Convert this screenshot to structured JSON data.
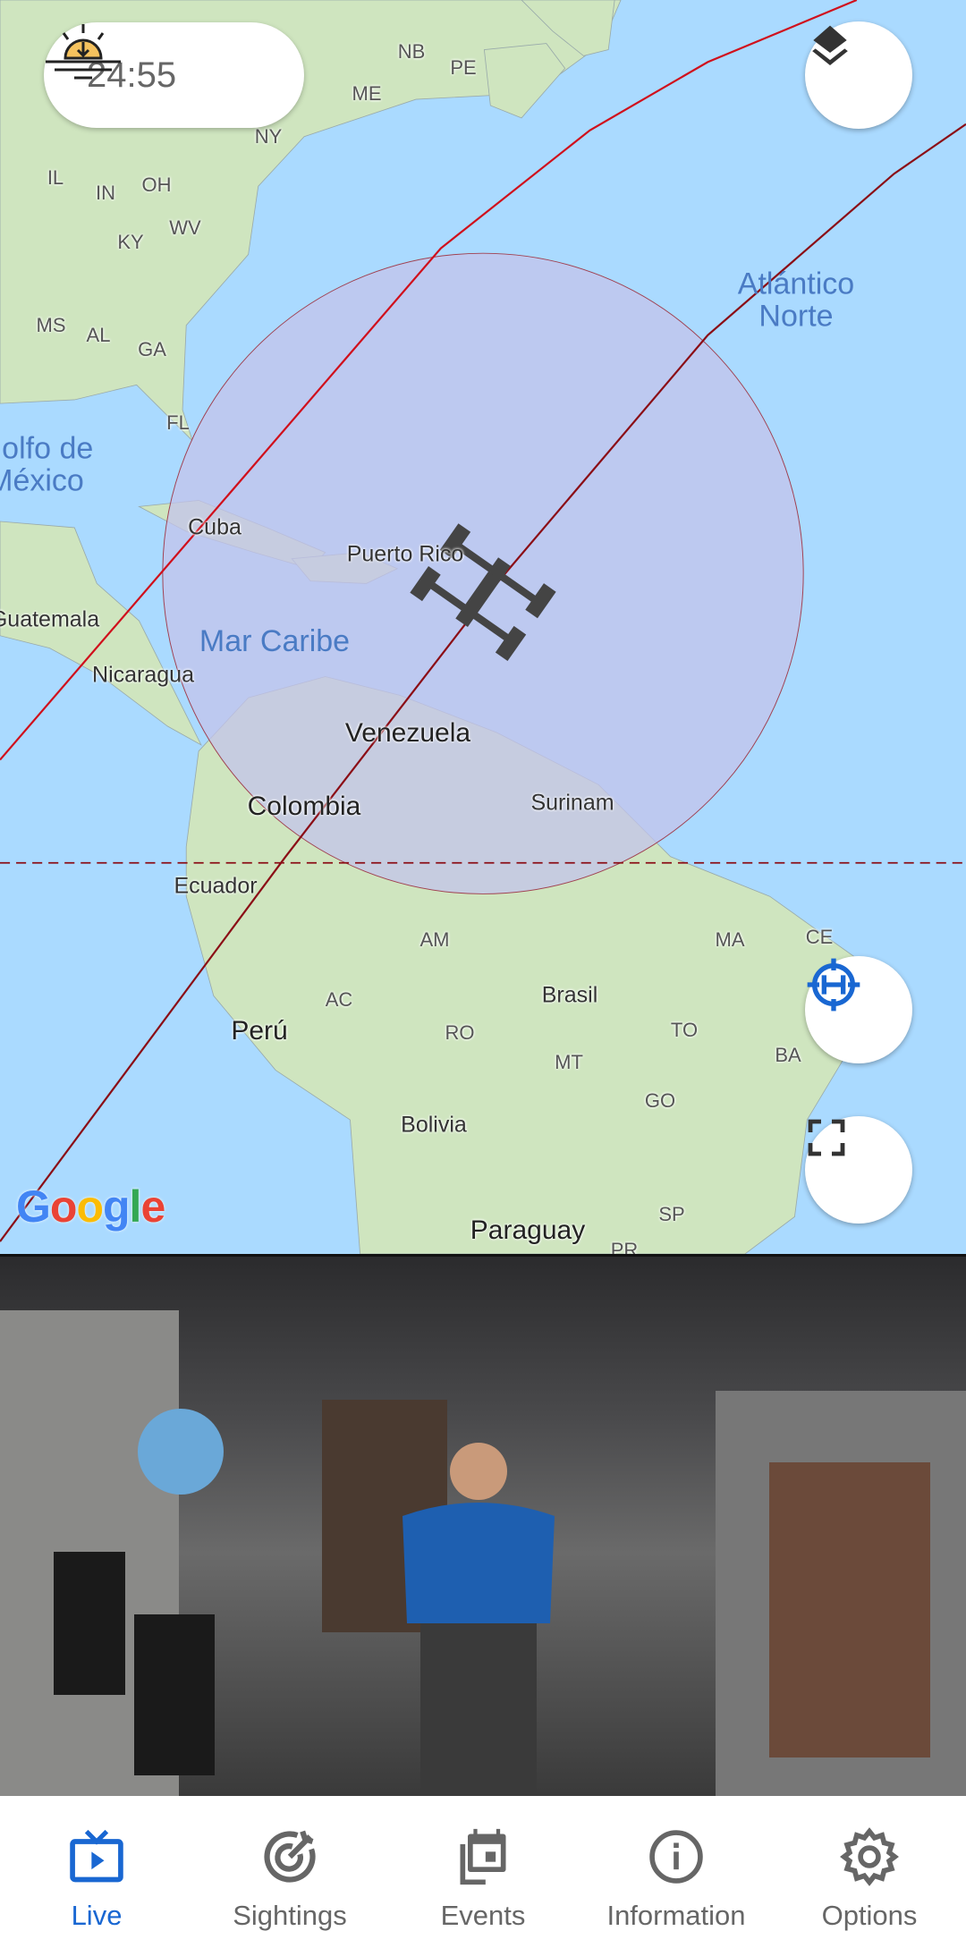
{
  "timer": {
    "icon": "sunset-icon",
    "value": "24:55"
  },
  "map": {
    "labels_states": [
      "NB",
      "PE",
      "ME",
      "NY",
      "IL",
      "IN",
      "OH",
      "WV",
      "KY",
      "MS",
      "AL",
      "GA",
      "FL",
      "AM",
      "MA",
      "CE",
      "AC",
      "RO",
      "TO",
      "MT",
      "BA",
      "GO",
      "SP",
      "PR"
    ],
    "labels_countries": [
      "Cuba",
      "Puerto Rico",
      "Nicaragua",
      "Guatemala",
      "Venezuela",
      "Colombia",
      "Surinam",
      "Ecuador",
      "Perú",
      "Brasil",
      "Bolivia",
      "Paraguay"
    ],
    "labels_seas": [
      "Atlántico Norte",
      "Golfo de México",
      "Mar Caribe"
    ],
    "attribution": "Google",
    "colors": {
      "orbit_current": "#d0101c",
      "orbit_next": "#8b0e16",
      "visibility_circle": "#c3c3eb",
      "ocean": "#aadaff",
      "land": "#cfe5bf"
    }
  },
  "buttons": {
    "layers": "layers-icon",
    "locate": "iss-locate-icon",
    "fullscreen": "fullscreen-icon"
  },
  "nav": {
    "items": [
      {
        "label": "Live",
        "icon": "live-tv-icon",
        "active": true
      },
      {
        "label": "Sightings",
        "icon": "target-icon"
      },
      {
        "label": "Events",
        "icon": "calendar-icon"
      },
      {
        "label": "Information",
        "icon": "info-icon"
      },
      {
        "label": "Options",
        "icon": "gear-icon"
      }
    ],
    "accent": "#1967d2"
  }
}
